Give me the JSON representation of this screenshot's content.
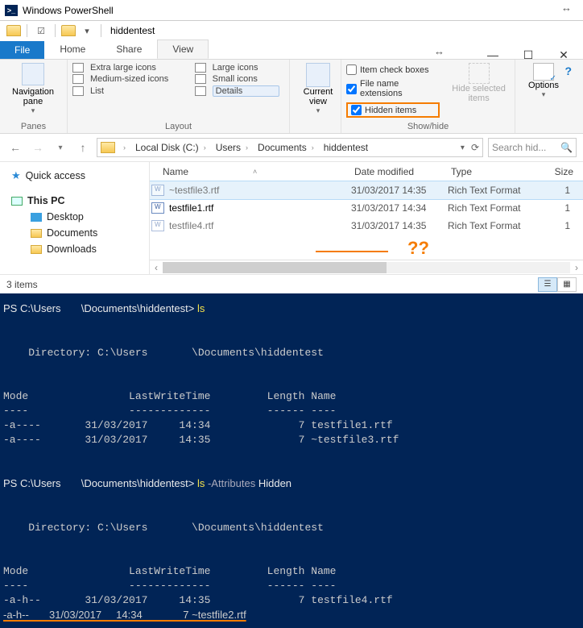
{
  "ps_title": "Windows PowerShell",
  "explorer": {
    "folder_name": "hiddentest",
    "tabs": {
      "file": "File",
      "home": "Home",
      "share": "Share",
      "view": "View"
    },
    "ribbon": {
      "nav_pane": "Navigation pane",
      "group_panes": "Panes",
      "layout": {
        "xl": "Extra large icons",
        "l": "Large icons",
        "m": "Medium-sized icons",
        "s": "Small icons",
        "list": "List",
        "details": "Details"
      },
      "group_layout": "Layout",
      "current_view": "Current view",
      "checks": {
        "item_boxes": "Item check boxes",
        "ext": "File name extensions",
        "hidden": "Hidden items"
      },
      "hide_selected": "Hide selected items",
      "group_showhide": "Show/hide",
      "options": "Options"
    },
    "breadcrumb": [
      "Local Disk (C:)",
      "Users",
      "Documents",
      "hiddentest"
    ],
    "search_placeholder": "Search hid...",
    "columns": {
      "name": "Name",
      "date": "Date modified",
      "type": "Type",
      "size": "Size"
    },
    "files": [
      {
        "name": "~testfile3.rtf",
        "date": "31/03/2017 14:35",
        "type": "Rich Text Format",
        "size": "1",
        "selected": true,
        "dim": true
      },
      {
        "name": "testfile1.rtf",
        "date": "31/03/2017 14:34",
        "type": "Rich Text Format",
        "size": "1",
        "selected": false,
        "dim": false
      },
      {
        "name": "testfile4.rtf",
        "date": "31/03/2017 14:35",
        "type": "Rich Text Format",
        "size": "1",
        "selected": false,
        "dim": true
      }
    ],
    "sidebar": {
      "quick_access": "Quick access",
      "this_pc": "This PC",
      "desktop": "Desktop",
      "documents": "Documents",
      "downloads": "Downloads"
    },
    "status": "3 items",
    "annotation": "??"
  },
  "console": {
    "prompt1": "PS C:\\Users       \\Documents\\hiddentest> ",
    "cmd1": "ls",
    "dir_line": "    Directory: C:\\Users       \\Documents\\hiddentest",
    "hdr": "Mode                LastWriteTime         Length Name",
    "hdr_ul": "----                -------------         ------ ----",
    "rows1": [
      "-a----       31/03/2017     14:34              7 testfile1.rtf",
      "-a----       31/03/2017     14:35              7 ~testfile3.rtf"
    ],
    "prompt2": "PS C:\\Users       \\Documents\\hiddentest> ",
    "cmd2a": "ls ",
    "cmd2b": "-Attributes",
    "cmd2c": " Hidden",
    "rows2": [
      "-a-h--       31/03/2017     14:35              7 testfile4.rtf",
      "-a-h--       31/03/2017     14:34              7 ~testfile2.rtf"
    ]
  }
}
